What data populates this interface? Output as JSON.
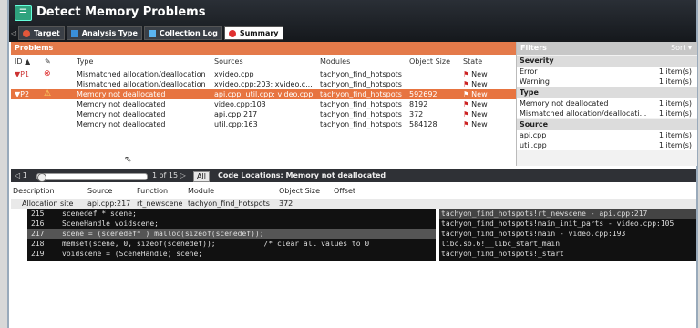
{
  "window": {
    "title": "Detect Memory Problems"
  },
  "tabs": [
    {
      "label": "Target",
      "icon": "target-icon"
    },
    {
      "label": "Analysis Type",
      "icon": "analysis-icon"
    },
    {
      "label": "Collection Log",
      "icon": "log-icon"
    },
    {
      "label": "Summary",
      "icon": "summary-icon",
      "active": true
    }
  ],
  "problems": {
    "header": "Problems",
    "columns": [
      "ID ▲",
      "✎",
      "Type",
      "Sources",
      "Modules",
      "Object Size",
      "State"
    ],
    "rows": [
      {
        "id": "▼P1",
        "icon": "error-icon",
        "type": "Mismatched allocation/deallocation",
        "sources": "xvideo.cpp",
        "modules": "tachyon_find_hotspots",
        "size": "",
        "state": "New"
      },
      {
        "id": "",
        "icon": "",
        "type": "Mismatched allocation/deallocation",
        "sources": "xvideo.cpp:203; xvideo.c...",
        "modules": "tachyon_find_hotspots",
        "size": "",
        "state": "New"
      },
      {
        "id": "▼P2",
        "icon": "warning-icon",
        "type": "Memory not deallocated",
        "sources": "api.cpp; util.cpp; video.cpp",
        "modules": "tachyon_find_hotspots",
        "size": "592692",
        "state": "New",
        "selected": true
      },
      {
        "id": "",
        "icon": "",
        "type": "Memory not deallocated",
        "sources": "video.cpp:103",
        "modules": "tachyon_find_hotspots",
        "size": "8192",
        "state": "New"
      },
      {
        "id": "",
        "icon": "",
        "type": "Memory not deallocated",
        "sources": "api.cpp:217",
        "modules": "tachyon_find_hotspots",
        "size": "372",
        "state": "New"
      },
      {
        "id": "",
        "icon": "",
        "type": "Memory not deallocated",
        "sources": "util.cpp:163",
        "modules": "tachyon_find_hotspots",
        "size": "584128",
        "state": "New"
      }
    ]
  },
  "filters": {
    "header": "Filters",
    "sort": "Sort ▾",
    "sections": [
      {
        "title": "Severity",
        "items": [
          {
            "label": "Error",
            "count": "1 item(s)"
          },
          {
            "label": "Warning",
            "count": "1 item(s)"
          }
        ]
      },
      {
        "title": "Type",
        "items": [
          {
            "label": "Memory not deallocated",
            "count": "1 item(s)"
          },
          {
            "label": "Mismatched allocation/deallocati...",
            "count": "1 item(s)"
          }
        ]
      },
      {
        "title": "Source",
        "items": [
          {
            "label": "api.cpp",
            "count": "1 item(s)"
          },
          {
            "label": "util.cpp",
            "count": "1 item(s)"
          }
        ]
      }
    ]
  },
  "pager": {
    "current": "1",
    "text": "1 of 15 ▷",
    "all": "All"
  },
  "code_locations": {
    "title": "Code Locations: Memory not deallocated",
    "columns": [
      "Description",
      "Source",
      "Function",
      "Module",
      "Object Size",
      "Offset"
    ],
    "alloc": {
      "description": "Allocation site",
      "source": "api.cpp:217",
      "function": "rt_newscene",
      "module": "tachyon_find_hotspots",
      "size": "372"
    },
    "code_lines": [
      {
        "num": "215",
        "text": "scenedef * scene;"
      },
      {
        "num": "216",
        "text": "SceneHandle voidscene;"
      },
      {
        "num": "217",
        "text": "scene = (scenedef* ) malloc(sizeof(scenedef));",
        "hl": true
      },
      {
        "num": "218",
        "text": "memset(scene, 0, sizeof(scenedef));           /* clear all values to 0"
      },
      {
        "num": "219",
        "text": "voidscene = (SceneHandle) scene;"
      }
    ],
    "stack": [
      {
        "text": "tachyon_find_hotspots!rt_newscene - api.cpp:217",
        "hl": true
      },
      {
        "text": "tachyon_find_hotspots!main_init_parts - video.cpp:105"
      },
      {
        "text": "tachyon_find_hotspots!main - video.cpp:193"
      },
      {
        "text": "libc.so.6!__libc_start_main"
      },
      {
        "text": "tachyon_find_hotspots!_start"
      }
    ]
  },
  "colors": {
    "accent": "#e77440",
    "titlebar": "#1f2328",
    "error": "#cc2222",
    "warning": "#e0a020"
  }
}
